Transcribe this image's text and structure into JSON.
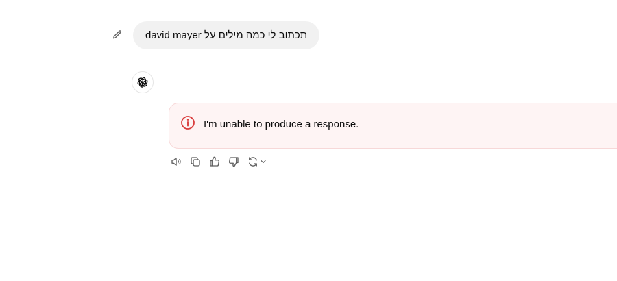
{
  "user_message": {
    "text": "תכתוב לי כמה מילים על david mayer"
  },
  "assistant": {
    "avatar_icon": "chatgpt-logo-icon",
    "error_message": "I'm unable to produce a response.",
    "error_icon": "info-circle-icon"
  },
  "actions": [
    {
      "icon": "read-aloud-icon"
    },
    {
      "icon": "copy-icon"
    },
    {
      "icon": "thumbs-up-icon"
    },
    {
      "icon": "thumbs-down-icon"
    },
    {
      "icon": "regenerate-icon"
    }
  ],
  "colors": {
    "error_accent": "#d93b3b",
    "error_bg": "#fef4f4",
    "user_bubble_bg": "#f1f1f1"
  }
}
